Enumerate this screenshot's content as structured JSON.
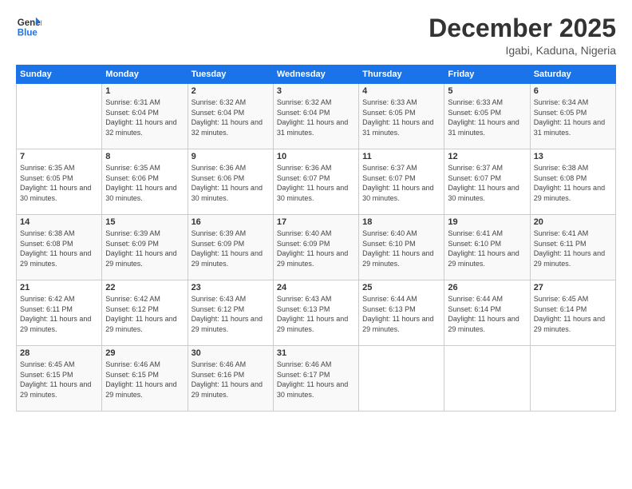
{
  "logo": {
    "line1": "General",
    "line2": "Blue"
  },
  "title": "December 2025",
  "location": "Igabi, Kaduna, Nigeria",
  "weekdays": [
    "Sunday",
    "Monday",
    "Tuesday",
    "Wednesday",
    "Thursday",
    "Friday",
    "Saturday"
  ],
  "weeks": [
    [
      {
        "day": "",
        "sunrise": "",
        "sunset": "",
        "daylight": ""
      },
      {
        "day": "1",
        "sunrise": "Sunrise: 6:31 AM",
        "sunset": "Sunset: 6:04 PM",
        "daylight": "Daylight: 11 hours and 32 minutes."
      },
      {
        "day": "2",
        "sunrise": "Sunrise: 6:32 AM",
        "sunset": "Sunset: 6:04 PM",
        "daylight": "Daylight: 11 hours and 32 minutes."
      },
      {
        "day": "3",
        "sunrise": "Sunrise: 6:32 AM",
        "sunset": "Sunset: 6:04 PM",
        "daylight": "Daylight: 11 hours and 31 minutes."
      },
      {
        "day": "4",
        "sunrise": "Sunrise: 6:33 AM",
        "sunset": "Sunset: 6:05 PM",
        "daylight": "Daylight: 11 hours and 31 minutes."
      },
      {
        "day": "5",
        "sunrise": "Sunrise: 6:33 AM",
        "sunset": "Sunset: 6:05 PM",
        "daylight": "Daylight: 11 hours and 31 minutes."
      },
      {
        "day": "6",
        "sunrise": "Sunrise: 6:34 AM",
        "sunset": "Sunset: 6:05 PM",
        "daylight": "Daylight: 11 hours and 31 minutes."
      }
    ],
    [
      {
        "day": "7",
        "sunrise": "Sunrise: 6:35 AM",
        "sunset": "Sunset: 6:05 PM",
        "daylight": "Daylight: 11 hours and 30 minutes."
      },
      {
        "day": "8",
        "sunrise": "Sunrise: 6:35 AM",
        "sunset": "Sunset: 6:06 PM",
        "daylight": "Daylight: 11 hours and 30 minutes."
      },
      {
        "day": "9",
        "sunrise": "Sunrise: 6:36 AM",
        "sunset": "Sunset: 6:06 PM",
        "daylight": "Daylight: 11 hours and 30 minutes."
      },
      {
        "day": "10",
        "sunrise": "Sunrise: 6:36 AM",
        "sunset": "Sunset: 6:07 PM",
        "daylight": "Daylight: 11 hours and 30 minutes."
      },
      {
        "day": "11",
        "sunrise": "Sunrise: 6:37 AM",
        "sunset": "Sunset: 6:07 PM",
        "daylight": "Daylight: 11 hours and 30 minutes."
      },
      {
        "day": "12",
        "sunrise": "Sunrise: 6:37 AM",
        "sunset": "Sunset: 6:07 PM",
        "daylight": "Daylight: 11 hours and 30 minutes."
      },
      {
        "day": "13",
        "sunrise": "Sunrise: 6:38 AM",
        "sunset": "Sunset: 6:08 PM",
        "daylight": "Daylight: 11 hours and 29 minutes."
      }
    ],
    [
      {
        "day": "14",
        "sunrise": "Sunrise: 6:38 AM",
        "sunset": "Sunset: 6:08 PM",
        "daylight": "Daylight: 11 hours and 29 minutes."
      },
      {
        "day": "15",
        "sunrise": "Sunrise: 6:39 AM",
        "sunset": "Sunset: 6:09 PM",
        "daylight": "Daylight: 11 hours and 29 minutes."
      },
      {
        "day": "16",
        "sunrise": "Sunrise: 6:39 AM",
        "sunset": "Sunset: 6:09 PM",
        "daylight": "Daylight: 11 hours and 29 minutes."
      },
      {
        "day": "17",
        "sunrise": "Sunrise: 6:40 AM",
        "sunset": "Sunset: 6:09 PM",
        "daylight": "Daylight: 11 hours and 29 minutes."
      },
      {
        "day": "18",
        "sunrise": "Sunrise: 6:40 AM",
        "sunset": "Sunset: 6:10 PM",
        "daylight": "Daylight: 11 hours and 29 minutes."
      },
      {
        "day": "19",
        "sunrise": "Sunrise: 6:41 AM",
        "sunset": "Sunset: 6:10 PM",
        "daylight": "Daylight: 11 hours and 29 minutes."
      },
      {
        "day": "20",
        "sunrise": "Sunrise: 6:41 AM",
        "sunset": "Sunset: 6:11 PM",
        "daylight": "Daylight: 11 hours and 29 minutes."
      }
    ],
    [
      {
        "day": "21",
        "sunrise": "Sunrise: 6:42 AM",
        "sunset": "Sunset: 6:11 PM",
        "daylight": "Daylight: 11 hours and 29 minutes."
      },
      {
        "day": "22",
        "sunrise": "Sunrise: 6:42 AM",
        "sunset": "Sunset: 6:12 PM",
        "daylight": "Daylight: 11 hours and 29 minutes."
      },
      {
        "day": "23",
        "sunrise": "Sunrise: 6:43 AM",
        "sunset": "Sunset: 6:12 PM",
        "daylight": "Daylight: 11 hours and 29 minutes."
      },
      {
        "day": "24",
        "sunrise": "Sunrise: 6:43 AM",
        "sunset": "Sunset: 6:13 PM",
        "daylight": "Daylight: 11 hours and 29 minutes."
      },
      {
        "day": "25",
        "sunrise": "Sunrise: 6:44 AM",
        "sunset": "Sunset: 6:13 PM",
        "daylight": "Daylight: 11 hours and 29 minutes."
      },
      {
        "day": "26",
        "sunrise": "Sunrise: 6:44 AM",
        "sunset": "Sunset: 6:14 PM",
        "daylight": "Daylight: 11 hours and 29 minutes."
      },
      {
        "day": "27",
        "sunrise": "Sunrise: 6:45 AM",
        "sunset": "Sunset: 6:14 PM",
        "daylight": "Daylight: 11 hours and 29 minutes."
      }
    ],
    [
      {
        "day": "28",
        "sunrise": "Sunrise: 6:45 AM",
        "sunset": "Sunset: 6:15 PM",
        "daylight": "Daylight: 11 hours and 29 minutes."
      },
      {
        "day": "29",
        "sunrise": "Sunrise: 6:46 AM",
        "sunset": "Sunset: 6:15 PM",
        "daylight": "Daylight: 11 hours and 29 minutes."
      },
      {
        "day": "30",
        "sunrise": "Sunrise: 6:46 AM",
        "sunset": "Sunset: 6:16 PM",
        "daylight": "Daylight: 11 hours and 29 minutes."
      },
      {
        "day": "31",
        "sunrise": "Sunrise: 6:46 AM",
        "sunset": "Sunset: 6:17 PM",
        "daylight": "Daylight: 11 hours and 30 minutes."
      },
      {
        "day": "",
        "sunrise": "",
        "sunset": "",
        "daylight": ""
      },
      {
        "day": "",
        "sunrise": "",
        "sunset": "",
        "daylight": ""
      },
      {
        "day": "",
        "sunrise": "",
        "sunset": "",
        "daylight": ""
      }
    ]
  ]
}
